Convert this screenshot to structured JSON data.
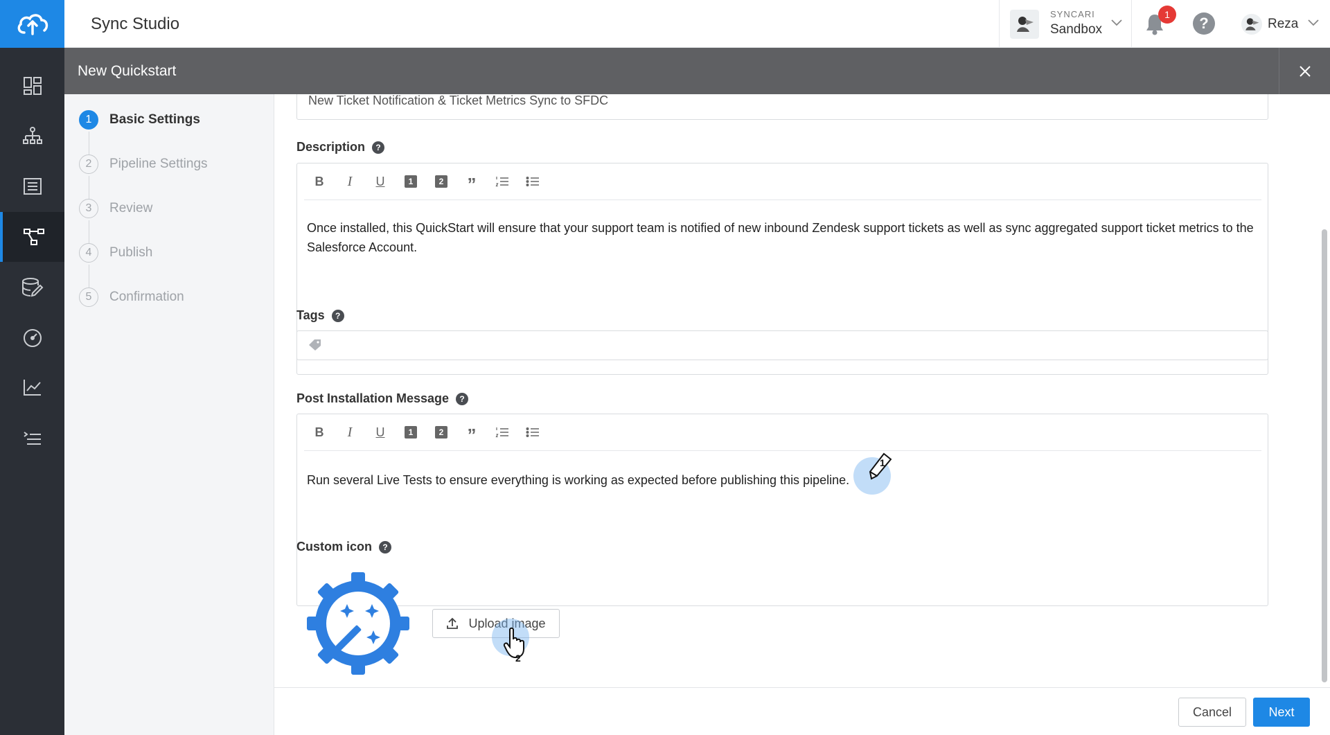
{
  "app": {
    "title": "Sync Studio"
  },
  "org": {
    "label": "SYNCARI",
    "name": "Sandbox"
  },
  "notifications": {
    "count": "1"
  },
  "user": {
    "name": "Reza"
  },
  "modal": {
    "title": "New Quickstart"
  },
  "steps": [
    {
      "num": "1",
      "label": "Basic Settings"
    },
    {
      "num": "2",
      "label": "Pipeline Settings"
    },
    {
      "num": "3",
      "label": "Review"
    },
    {
      "num": "4",
      "label": "Publish"
    },
    {
      "num": "5",
      "label": "Confirmation"
    }
  ],
  "form": {
    "title_value": "New Ticket Notification & Ticket Metrics Sync to SFDC",
    "description": {
      "label": "Description",
      "text": "Once installed, this QuickStart will ensure that your support team is notified of new inbound Zendesk support tickets as well as sync aggregated support ticket metrics to the Salesforce Account."
    },
    "tags": {
      "label": "Tags"
    },
    "post_install": {
      "label": "Post Installation Message",
      "text": "Run several Live Tests to ensure everything is working as expected before publishing this pipeline."
    },
    "custom_icon": {
      "label": "Custom icon",
      "upload_label": "Upload image"
    }
  },
  "toolbar": {
    "bold": "B",
    "italic": "I",
    "underline": "U",
    "h1": "1",
    "h2": "2",
    "quote": "”"
  },
  "cursors": {
    "first": "1",
    "second": "2"
  },
  "footer": {
    "cancel": "Cancel",
    "next": "Next"
  },
  "colors": {
    "accent": "#1e88e5",
    "nav_bg": "#2b2f36",
    "modal_header": "#5f6063",
    "badge": "#e53935"
  }
}
